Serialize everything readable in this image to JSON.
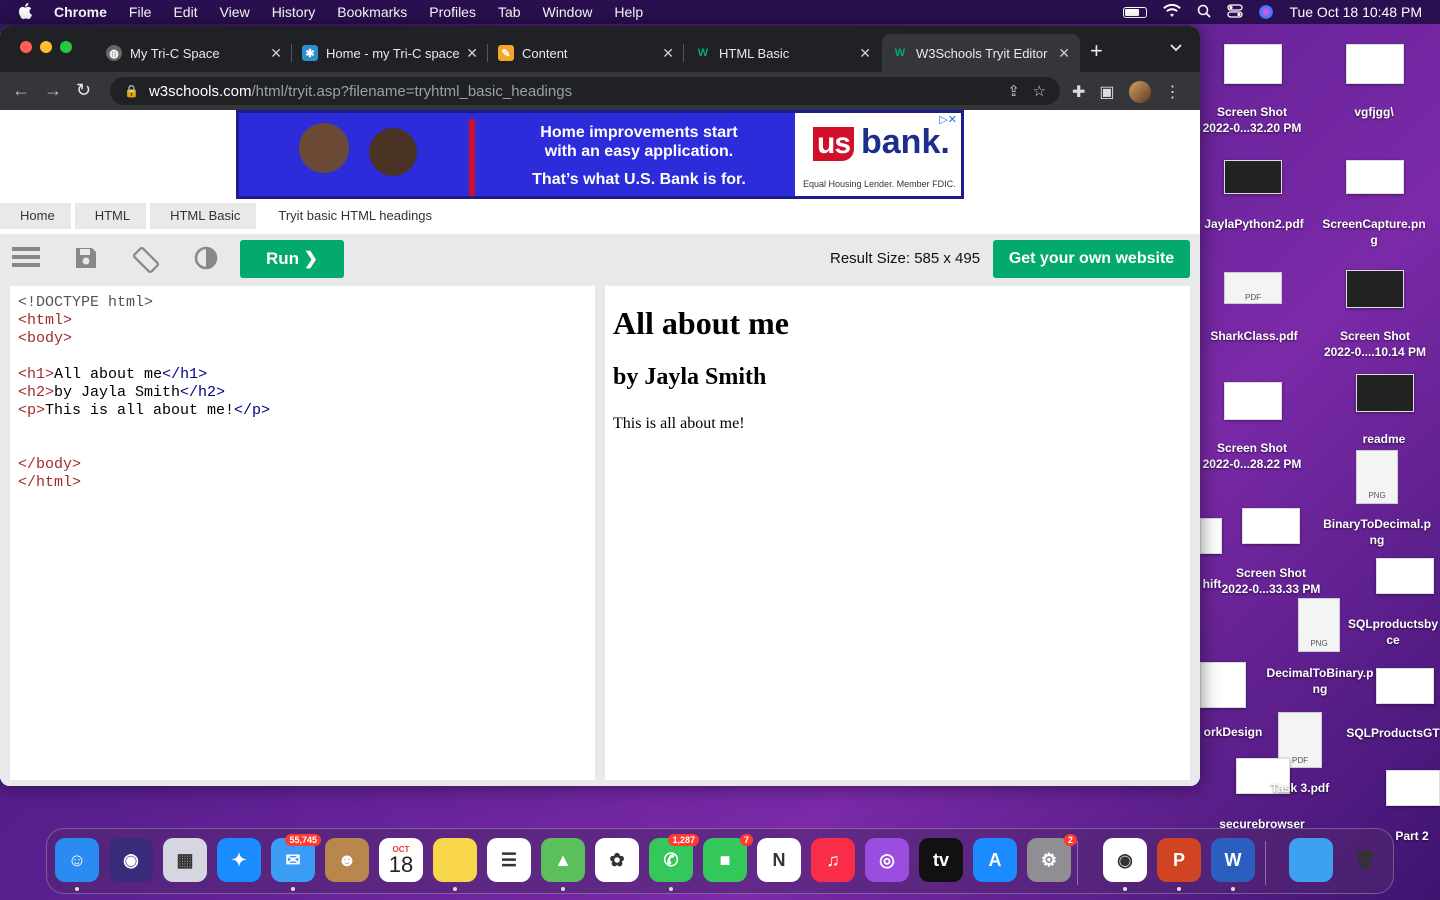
{
  "menubar": {
    "app": "Chrome",
    "items": [
      "File",
      "Edit",
      "View",
      "History",
      "Bookmarks",
      "Profiles",
      "Tab",
      "Window",
      "Help"
    ],
    "clock": "Tue Oct 18  10:48 PM"
  },
  "tabs": [
    {
      "title": "My Tri-C Space",
      "fav": "W",
      "fav_bg": "#888",
      "active": false
    },
    {
      "title": "Home - my Tri-C space",
      "fav": "✱",
      "fav_bg": "#2b8fc9",
      "active": false
    },
    {
      "title": "Content",
      "fav": "✎",
      "fav_bg": "#f5a623",
      "active": false
    },
    {
      "title": "HTML Basic",
      "fav": "W",
      "fav_bg": "#04aa6d",
      "active": false
    },
    {
      "title": "W3Schools Tryit Editor",
      "fav": "W",
      "fav_bg": "#04aa6d",
      "active": true
    }
  ],
  "address": {
    "host": "w3schools.com",
    "path": "/html/tryit.asp?filename=tryhtml_basic_headings"
  },
  "ad": {
    "line1": "Home improvements start",
    "line2": "with an easy application.",
    "line3": "That’s what U.S. Bank is for.",
    "brand_us": "us",
    "brand_bank": "bank.",
    "fine": "Equal Housing Lender. Member FDIC."
  },
  "breadcrumb": [
    "Home",
    "HTML",
    "HTML Basic",
    "Tryit basic HTML headings"
  ],
  "toolbar": {
    "run": "Run ❯",
    "result_size": "Result Size: 585 x 495",
    "own_site": "Get your own website"
  },
  "code": [
    "<!DOCTYPE html>",
    "<html>",
    "<body>",
    "",
    "<h1>All about me</h1>",
    "<h2>by Jayla Smith</h2>",
    "<p>This is all about me!</p>",
    "",
    "",
    "</body>",
    "</html>"
  ],
  "result": {
    "h1": "All about me",
    "h2": "by Jayla Smith",
    "p": "This is all about me!"
  },
  "desktop": [
    {
      "label": "Screen Shot\n2022-0...32.20 PM"
    },
    {
      "label": "vgfjgg\\"
    },
    {
      "label": "JaylaPython2.pdf"
    },
    {
      "label": "ScreenCapture.pn\ng"
    },
    {
      "label": "SharkClass.pdf"
    },
    {
      "label": "Screen Shot\n2022-0....10.14 PM"
    },
    {
      "label": "Screen Shot\n2022-0...28.22 PM"
    },
    {
      "label": "readme"
    },
    {
      "label": "BinaryToDecimal.p\nng"
    },
    {
      "label": "Screen Shot\n2022-0...33.33 PM"
    },
    {
      "label": "SQLproductsby\nce"
    },
    {
      "label": "DecimalToBinary.p\nng"
    },
    {
      "label": "orkDesign"
    },
    {
      "label": "SQLProductsGT"
    },
    {
      "label": "Task 3.pdf"
    },
    {
      "label": "securebrowser"
    },
    {
      "label": "Part 2"
    },
    {
      "label": "hift"
    }
  ],
  "dock": [
    {
      "name": "finder",
      "label": "☺",
      "bg": "#2a8cf0"
    },
    {
      "name": "siri",
      "label": "◉",
      "bg": "#3a2a7a"
    },
    {
      "name": "launchpad",
      "label": "▦",
      "bg": "#d6d6e0"
    },
    {
      "name": "safari",
      "label": "✦",
      "bg": "#1a8cff"
    },
    {
      "name": "mail",
      "label": "✉",
      "bg": "#3a9cf5",
      "badge": "55,745"
    },
    {
      "name": "contacts",
      "label": "☻",
      "bg": "#b8874d"
    },
    {
      "name": "calendar",
      "label": "18",
      "bg": "#fff",
      "month": "OCT"
    },
    {
      "name": "notes",
      "label": "",
      "bg": "#f7d64a"
    },
    {
      "name": "reminders",
      "label": "☰",
      "bg": "#fff"
    },
    {
      "name": "maps",
      "label": "▲",
      "bg": "#5bbf5b"
    },
    {
      "name": "photos",
      "label": "✿",
      "bg": "#fff"
    },
    {
      "name": "messages",
      "label": "✆",
      "bg": "#34c759",
      "badge": "1,287"
    },
    {
      "name": "facetime",
      "label": "■",
      "bg": "#34c759",
      "badge": "7"
    },
    {
      "name": "news",
      "label": "N",
      "bg": "#fff"
    },
    {
      "name": "music",
      "label": "♫",
      "bg": "#fa2d48"
    },
    {
      "name": "podcasts",
      "label": "◎",
      "bg": "#9b4de0"
    },
    {
      "name": "tv",
      "label": "tv",
      "bg": "#111"
    },
    {
      "name": "appstore",
      "label": "A",
      "bg": "#1a8cff"
    },
    {
      "name": "settings",
      "label": "⚙",
      "bg": "#8e8e93",
      "badge": "2"
    },
    {
      "name": "chrome",
      "label": "◉",
      "bg": "#fff"
    },
    {
      "name": "powerpoint",
      "label": "P",
      "bg": "#d04423"
    },
    {
      "name": "word",
      "label": "W",
      "bg": "#2b5fbf"
    },
    {
      "name": "folder",
      "label": "",
      "bg": "#3ea0f0"
    },
    {
      "name": "trash",
      "label": "🗑",
      "bg": "transparent"
    }
  ]
}
